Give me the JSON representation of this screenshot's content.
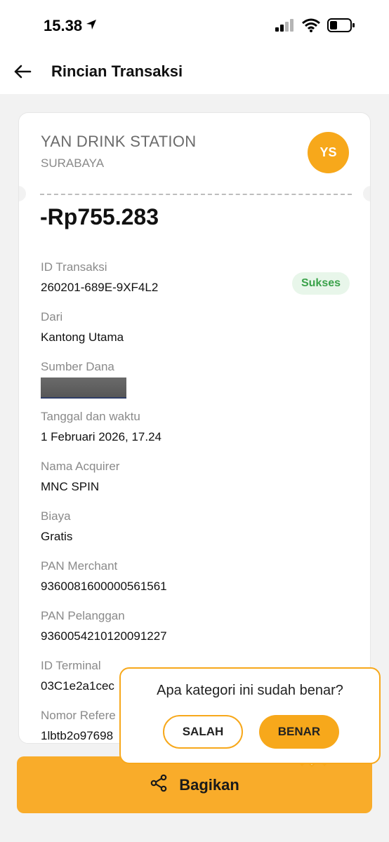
{
  "status_bar": {
    "time": "15.38"
  },
  "header": {
    "title": "Rincian Transaksi"
  },
  "merchant": {
    "name": "YAN DRINK STATION",
    "city": "SURABAYA",
    "initials": "YS"
  },
  "amount": "-Rp755.283",
  "status_badge": "Sukses",
  "fields": [
    {
      "label": "ID Transaksi",
      "value": "260201-689E-9XF4L2"
    },
    {
      "label": "Dari",
      "value": "Kantong Utama"
    },
    {
      "label": "Sumber Dana",
      "value": ""
    },
    {
      "label": "Tanggal dan waktu",
      "value": "1 Februari 2026, 17.24"
    },
    {
      "label": "Nama Acquirer",
      "value": "MNC SPIN"
    },
    {
      "label": "Biaya",
      "value": "Gratis"
    },
    {
      "label": "PAN Merchant",
      "value": "936008160000056156​1"
    },
    {
      "label": "PAN Pelanggan",
      "value": "9360054210120091227"
    },
    {
      "label": "ID Terminal",
      "value": "03C1e2a1cec"
    },
    {
      "label": "Nomor Refere",
      "value": "1lbtb2o97698"
    }
  ],
  "popup": {
    "question": "Apa kategori ini sudah benar?",
    "no_label": "SALAH",
    "yes_label": "BENAR"
  },
  "cta": {
    "label": "Bagikan"
  },
  "colors": {
    "accent": "#f7a81b",
    "success": "#3aa24a",
    "success_bg": "#e8f6ea"
  },
  "icons": [
    "location-arrow-icon",
    "signal-icon",
    "wifi-icon",
    "battery-icon",
    "back-arrow-icon",
    "share-icon"
  ]
}
